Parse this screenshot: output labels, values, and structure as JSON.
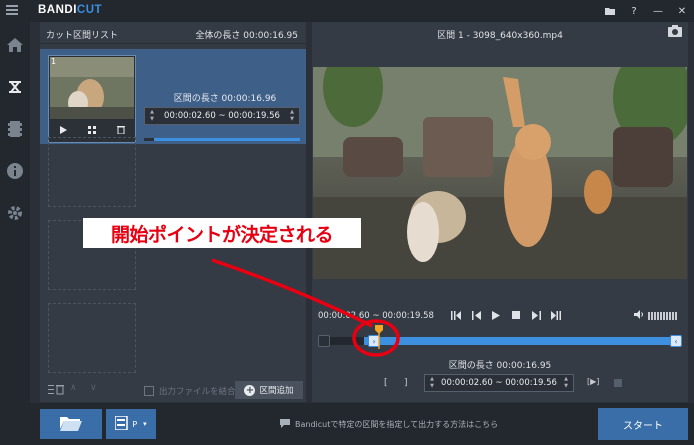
{
  "app": {
    "logo_main": "BANDI",
    "logo_accent": "CUT"
  },
  "titlebar_icons": [
    "folder-icon",
    "help-icon",
    "minimize-icon",
    "close-icon"
  ],
  "sidebar_icons": [
    "home-icon",
    "cut-icon",
    "film-icon",
    "info-icon",
    "settings-icon",
    "record-icon"
  ],
  "left_panel": {
    "title": "カット区間リスト",
    "total": "全体の長さ 00:00:16.95",
    "segment": {
      "number": "1",
      "length": "区間の長さ 00:00:16.96",
      "range": "00:00:02.60 ~ 00:00:19.56"
    },
    "merge_label": "出力ファイルを結合",
    "add_button": "区間追加"
  },
  "right_panel": {
    "title": "区間 1 - 3098_640x360.mp4",
    "time_start": "00:00:02.60",
    "time_end": "00:00:19.58",
    "length": "区間の長さ 00:00:16.95",
    "range": "00:00:02.60 ~ 00:00:19.56",
    "play_label": "[▶]"
  },
  "footer": {
    "mode_label": "P",
    "hint": "Bandicutで特定の区間を指定して出力する方法はこちら",
    "start": "スタート"
  },
  "annotation": {
    "text": "開始ポイントが決定される",
    "color": "#e60012"
  },
  "colors": {
    "accent": "#3d8fe0",
    "button": "#3a6ea8"
  }
}
